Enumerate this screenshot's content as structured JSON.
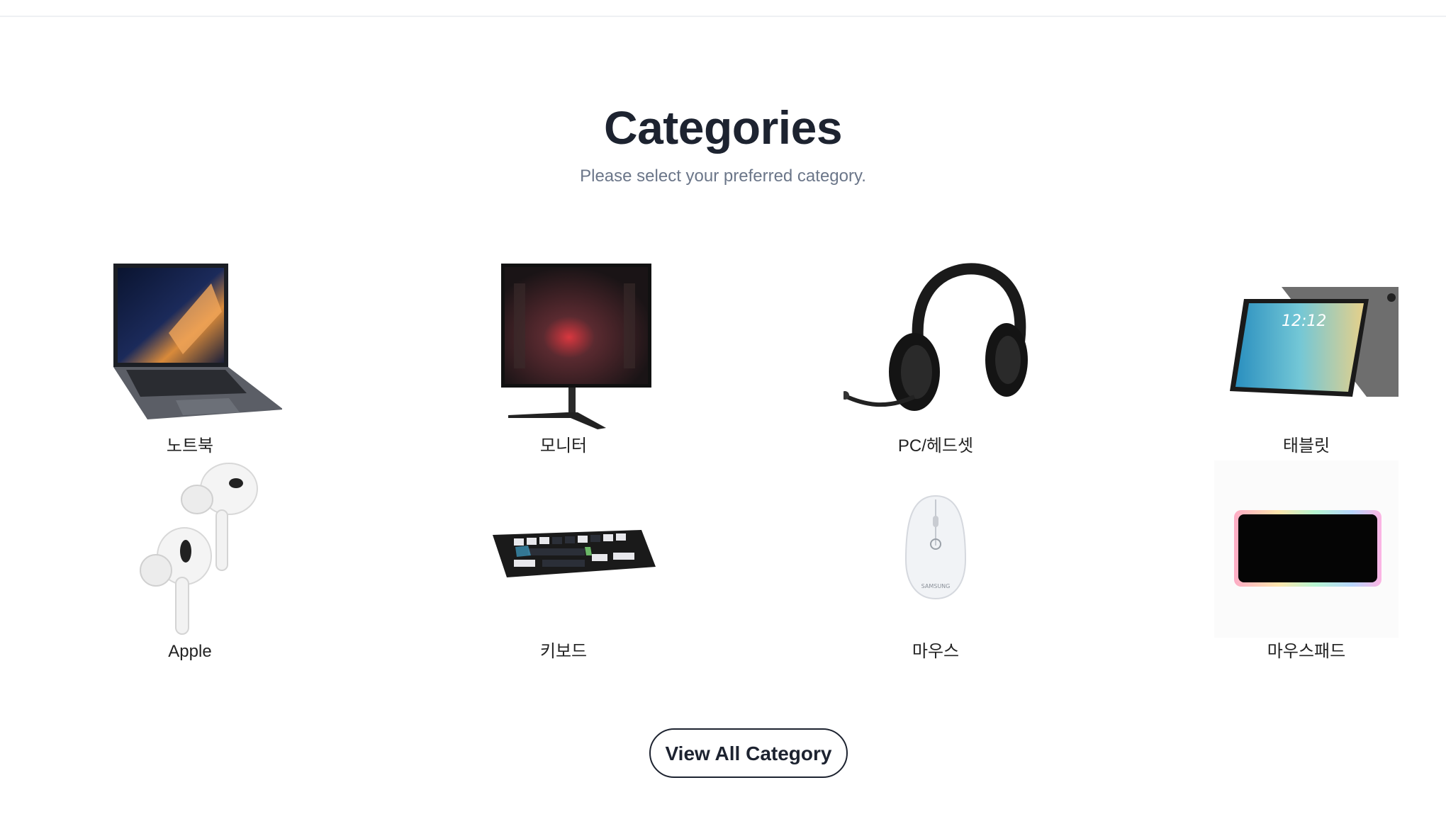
{
  "header": {
    "title": "Categories",
    "subtitle": "Please select your preferred category."
  },
  "categories": [
    {
      "label": "노트북",
      "icon": "laptop-image"
    },
    {
      "label": "모니터",
      "icon": "monitor-image"
    },
    {
      "label": "PC/헤드셋",
      "icon": "headset-image"
    },
    {
      "label": "태블릿",
      "icon": "tablet-image"
    },
    {
      "label": "Apple",
      "icon": "airpods-image"
    },
    {
      "label": "키보드",
      "icon": "keyboard-image"
    },
    {
      "label": "마우스",
      "icon": "mouse-image"
    },
    {
      "label": "마우스패드",
      "icon": "mousepad-image"
    }
  ],
  "tablet_screen_time": "12:12",
  "mouse_brand": "SAMSUNG",
  "view_all_button": "View All Category"
}
